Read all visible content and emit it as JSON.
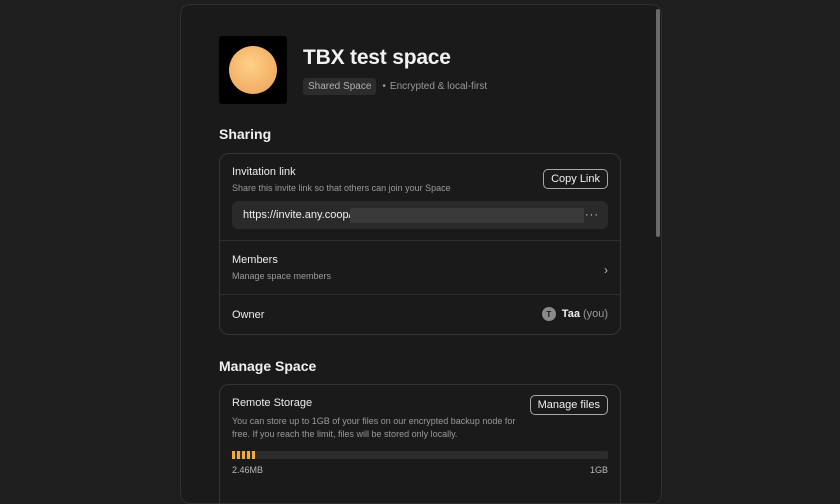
{
  "space": {
    "name": "TBX test space",
    "badge": "Shared Space",
    "separator": "•",
    "encryption": "Encrypted & local-first"
  },
  "sharing": {
    "section_title": "Sharing",
    "invitation": {
      "label": "Invitation link",
      "description": "Share this invite link so that others can join your Space",
      "copy_button": "Copy Link",
      "link": "https://invite.any.coop/",
      "more": "···"
    },
    "members": {
      "label": "Members",
      "description": "Manage space members",
      "chevron": "›"
    },
    "owner": {
      "label": "Owner",
      "avatar_initial": "T",
      "name": "Taa",
      "you": "(you)"
    }
  },
  "manage": {
    "section_title": "Manage Space",
    "remote_storage": {
      "label": "Remote Storage",
      "description": "You can store up to 1GB of your files on our encrypted backup node for free. If you reach the limit, files will be stored only locally.",
      "button": "Manage files",
      "used": "2.46MB",
      "limit": "1GB",
      "progress_fraction": 0.06
    }
  },
  "colors": {
    "accent": "#f0a844",
    "background": "#1a1a1a"
  }
}
